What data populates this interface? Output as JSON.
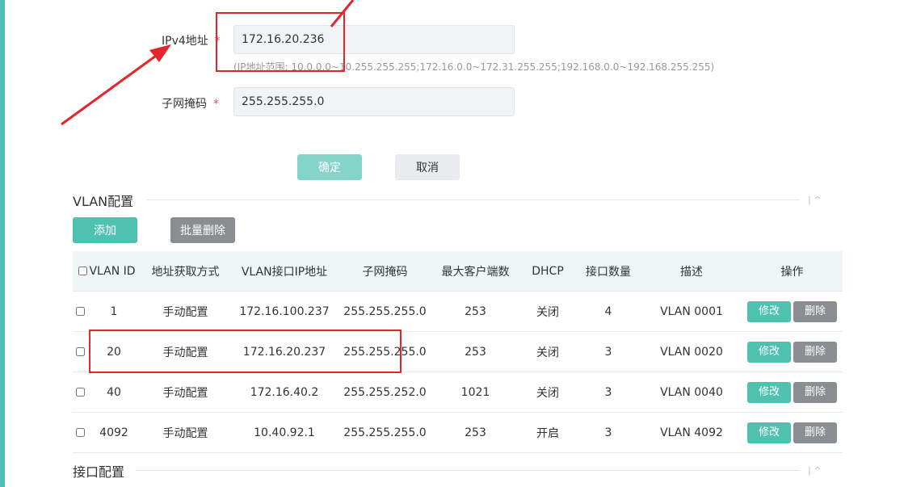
{
  "form": {
    "ipv4_label": "IPv4地址",
    "ipv4_value": "172.16.20.236",
    "ipv4_hint": "(IP地址范围: 10.0.0.0~10.255.255.255;172.16.0.0~172.31.255.255;192.168.0.0~192.168.255.255)",
    "subnet_label": "子网掩码",
    "subnet_value": "255.255.255.0",
    "required_mark": "*",
    "confirm_label": "确定",
    "cancel_label": "取消"
  },
  "vlan_section": {
    "title": "VLAN配置",
    "add_label": "添加",
    "batch_delete_label": "批量删除",
    "columns": [
      "VLAN ID",
      "地址获取方式",
      "VLAN接口IP地址",
      "子网掩码",
      "最大客户端数",
      "DHCP",
      "接口数量",
      "描述",
      "操作"
    ],
    "edit_label": "修改",
    "delete_label": "删除",
    "rows": [
      {
        "vlan_id": "1",
        "mode": "手动配置",
        "ip": "172.16.100.237",
        "mask": "255.255.255.0",
        "max_clients": "253",
        "dhcp": "关闭",
        "ports": "4",
        "desc": "VLAN 0001"
      },
      {
        "vlan_id": "20",
        "mode": "手动配置",
        "ip": "172.16.20.237",
        "mask": "255.255.255.0",
        "max_clients": "253",
        "dhcp": "关闭",
        "ports": "3",
        "desc": "VLAN 0020"
      },
      {
        "vlan_id": "40",
        "mode": "手动配置",
        "ip": "172.16.40.2",
        "mask": "255.255.252.0",
        "max_clients": "1021",
        "dhcp": "关闭",
        "ports": "3",
        "desc": "VLAN 0040"
      },
      {
        "vlan_id": "4092",
        "mode": "手动配置",
        "ip": "10.40.92.1",
        "mask": "255.255.255.0",
        "max_clients": "253",
        "dhcp": "开启",
        "ports": "3",
        "desc": "VLAN 4092"
      }
    ]
  },
  "port_section": {
    "title": "接口配置"
  },
  "collapse_glyph": "| ^",
  "colors": {
    "accent": "#4fc1b0",
    "annotation_red": "#e3262b",
    "delete_gray": "#8a8d91",
    "table_header_bg": "#eef6f6"
  }
}
